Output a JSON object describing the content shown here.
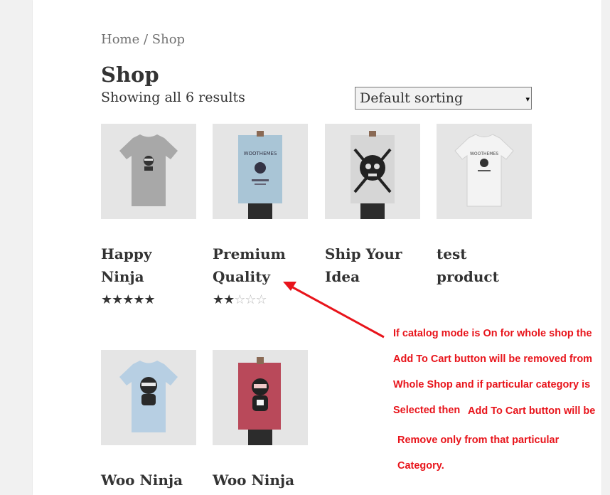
{
  "breadcrumb": {
    "home": "Home",
    "separator": " / ",
    "current": "Shop"
  },
  "page_title": "Shop",
  "result_count": "Showing all 6 results",
  "sorting": {
    "selected": "Default sorting"
  },
  "products": [
    {
      "name": "Happy Ninja",
      "rating": 5,
      "image": "grey-tshirt-ninja"
    },
    {
      "name": "Premium Quality",
      "rating": 2,
      "image": "blue-poster-woothemes"
    },
    {
      "name": "Ship Your Idea",
      "rating": null,
      "image": "grey-poster-skull"
    },
    {
      "name": "test product",
      "rating": null,
      "image": "white-tshirt-woothemes"
    },
    {
      "name": "Woo Ninja",
      "rating": null,
      "image": "light-blue-tshirt-ninja"
    },
    {
      "name": "Woo Ninja",
      "rating": null,
      "image": "red-poster-ninja"
    }
  ],
  "annotation": {
    "color": "#e8141b",
    "lines": [
      "If catalog mode is On for whole shop the",
      "Add To Cart button will be removed from",
      "Whole Shop and if particular category is",
      "Selected then",
      "Add To Cart button will be",
      "Remove only from that particular",
      "Category."
    ]
  }
}
